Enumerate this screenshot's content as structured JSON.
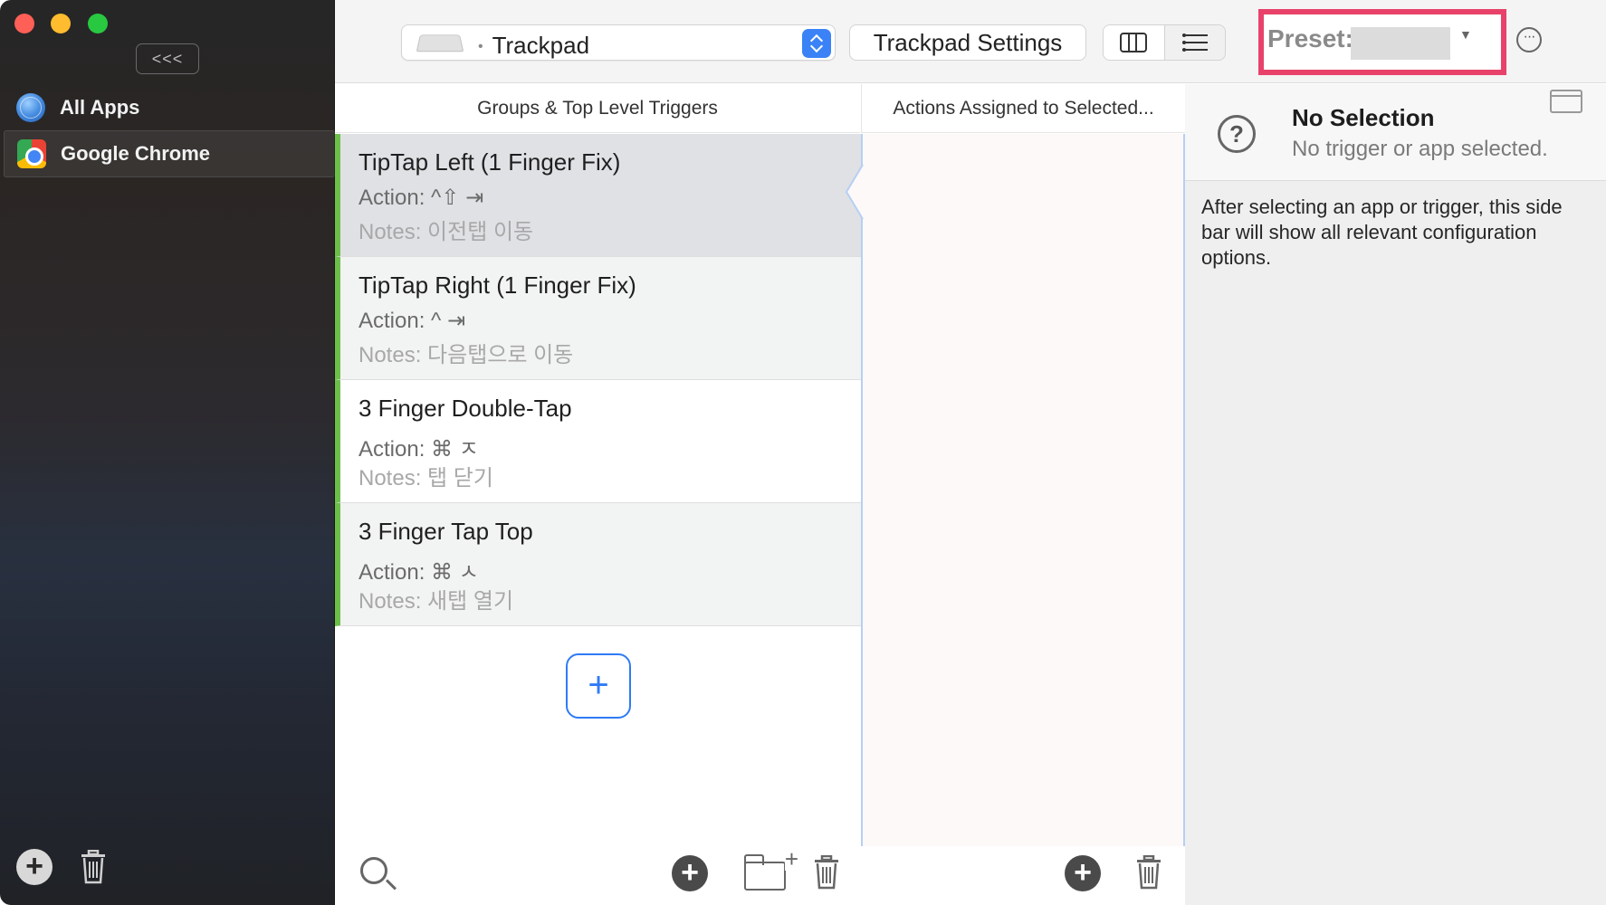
{
  "sidebar": {
    "collapse_label": "<<<",
    "apps": [
      {
        "label": "All Apps",
        "icon": "globe-icon"
      },
      {
        "label": "Google Chrome",
        "icon": "chrome-icon"
      }
    ]
  },
  "toolbar": {
    "device_label": "Trackpad",
    "settings_label": "Trackpad Settings",
    "preset_label": "Preset:",
    "preset_value": ""
  },
  "columns": {
    "triggers_header": "Groups & Top Level Triggers",
    "actions_header": "Actions Assigned to Selected..."
  },
  "triggers": [
    {
      "title": "TipTap Left (1 Finger Fix)",
      "action": "Action: ^⇧ ⇥",
      "notes": "Notes: 이전탭 이동"
    },
    {
      "title": "TipTap Right (1 Finger Fix)",
      "action": "Action: ^ ⇥",
      "notes": "Notes: 다음탭으로 이동"
    },
    {
      "title": "3 Finger Double-Tap",
      "action": "Action: ⌘ ㅈ",
      "notes": "Notes: 탭 닫기"
    },
    {
      "title": "3 Finger Tap Top",
      "action": "Action: ⌘ ㅅ",
      "notes": "Notes: 새탭 열기"
    }
  ],
  "add_trigger_label": "+",
  "inspector": {
    "title": "No Selection",
    "subtitle": "No trigger or app selected.",
    "help": "After selecting an app or trigger, this side bar will show all relevant configuration options."
  },
  "colors": {
    "accent": "#2f7bf5",
    "trigger_bar": "#6cc04a",
    "highlight": "#e8426a"
  }
}
